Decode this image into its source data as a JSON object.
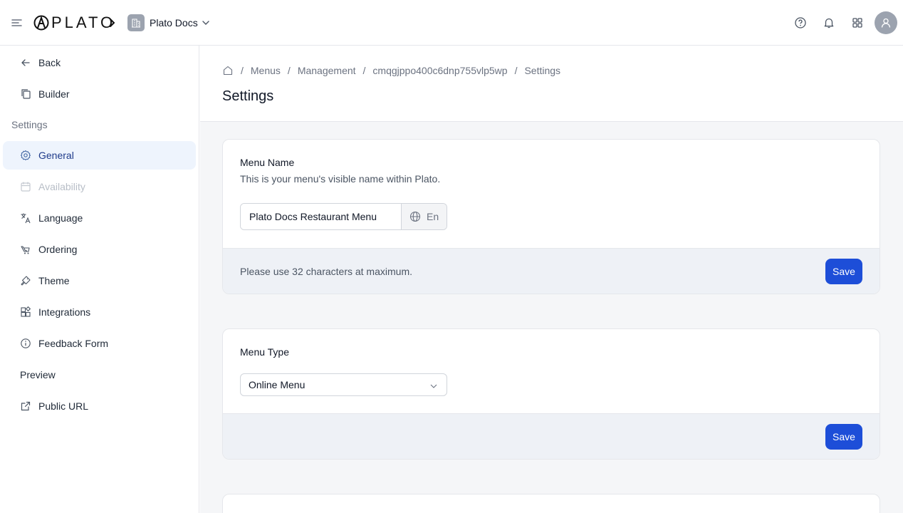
{
  "topbar": {
    "logo_text": "PLATO",
    "workspace_name": "Plato Docs",
    "icons": [
      "menu-icon",
      "help-icon",
      "bell-icon",
      "apps-icon",
      "user-icon"
    ]
  },
  "sidebar": {
    "back_label": "Back",
    "builder_label": "Builder",
    "settings_heading": "Settings",
    "items": [
      {
        "label": "General",
        "icon": "gear-icon",
        "state": "active"
      },
      {
        "label": "Availability",
        "icon": "calendar-icon",
        "state": "disabled"
      },
      {
        "label": "Language",
        "icon": "translate-icon",
        "state": "normal"
      },
      {
        "label": "Ordering",
        "icon": "ordering-icon",
        "state": "normal"
      },
      {
        "label": "Theme",
        "icon": "brush-icon",
        "state": "normal"
      },
      {
        "label": "Integrations",
        "icon": "integrations-icon",
        "state": "normal"
      },
      {
        "label": "Feedback Form",
        "icon": "info-icon",
        "state": "normal"
      }
    ],
    "preview_heading": "Preview",
    "public_url_label": "Public URL"
  },
  "breadcrumb": {
    "items": [
      "Menus",
      "Management",
      "cmqgjppo400c6dnp755vlp5wp",
      "Settings"
    ]
  },
  "page_title": "Settings",
  "menu_name_card": {
    "title": "Menu Name",
    "description": "This is your menu's visible name within Plato.",
    "input_value": "Plato Docs Restaurant Menu",
    "language_code": "En",
    "hint": "Please use 32 characters at maximum.",
    "save_label": "Save"
  },
  "menu_type_card": {
    "title": "Menu Type",
    "selected_value": "Online Menu",
    "save_label": "Save"
  },
  "colors": {
    "primary_button": "#1d4ed8",
    "active_nav_bg": "#eef4fd",
    "footer_bg": "#eef1f6",
    "content_bg": "#f5f6f8"
  }
}
